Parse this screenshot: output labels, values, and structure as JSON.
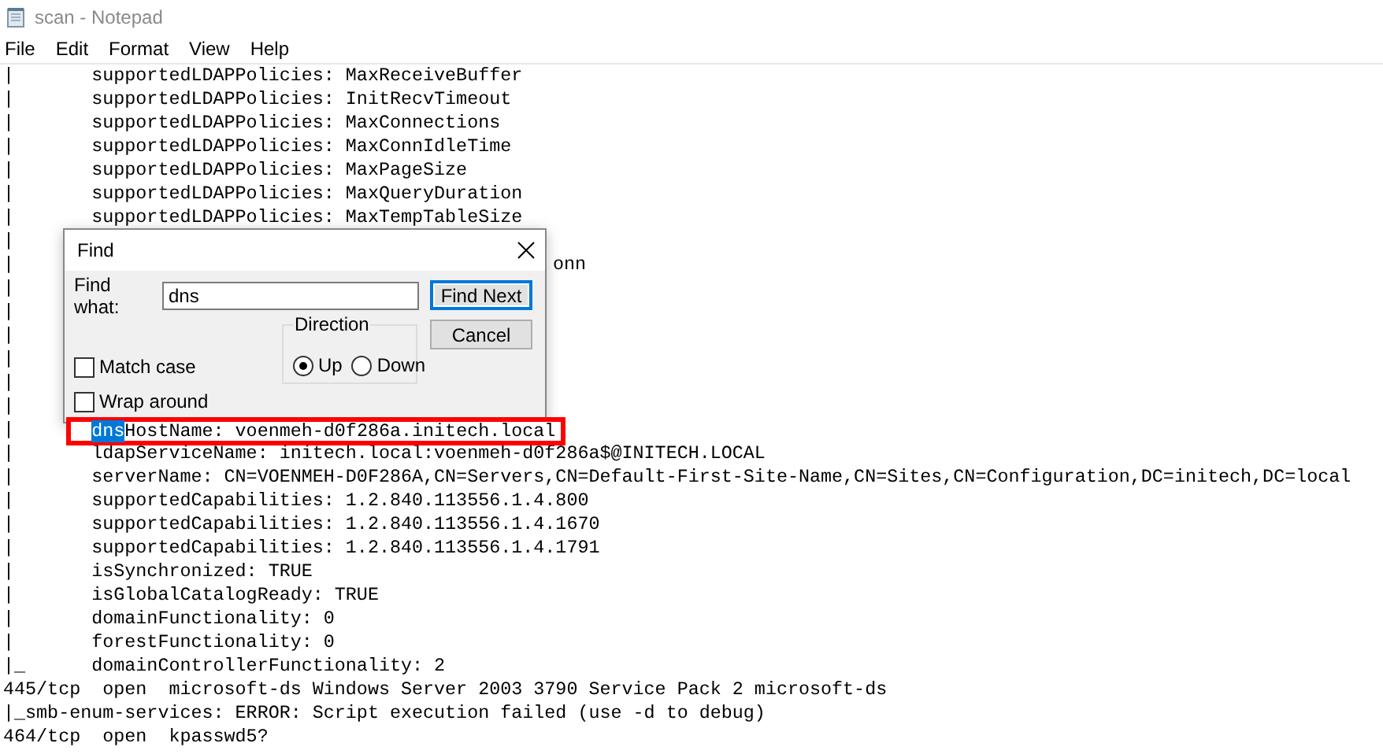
{
  "window": {
    "title": "scan - Notepad"
  },
  "menu": [
    "File",
    "Edit",
    "Format",
    "View",
    "Help"
  ],
  "lines": [
    {
      "kind": "plain",
      "text": "|       supportedLDAPPolicies: MaxReceiveBuffer"
    },
    {
      "kind": "plain",
      "text": "|       supportedLDAPPolicies: InitRecvTimeout"
    },
    {
      "kind": "plain",
      "text": "|       supportedLDAPPolicies: MaxConnections"
    },
    {
      "kind": "plain",
      "text": "|       supportedLDAPPolicies: MaxConnIdleTime"
    },
    {
      "kind": "plain",
      "text": "|       supportedLDAPPolicies: MaxPageSize"
    },
    {
      "kind": "plain",
      "text": "|       supportedLDAPPolicies: MaxQueryDuration"
    },
    {
      "kind": "plain",
      "text": "|       supportedLDAPPolicies: MaxTempTableSize"
    },
    {
      "kind": "plain",
      "text": "|"
    },
    {
      "kind": "covered",
      "text": "|",
      "tail": "onn"
    },
    {
      "kind": "plain",
      "text": "|"
    },
    {
      "kind": "plain",
      "text": "|"
    },
    {
      "kind": "plain",
      "text": "|"
    },
    {
      "kind": "plain",
      "text": "|"
    },
    {
      "kind": "plain",
      "text": "|"
    },
    {
      "kind": "plain",
      "text": "|"
    },
    {
      "kind": "match",
      "text": "|       ",
      "match": "dns",
      "tail": "HostName: voenmeh-d0f286a.initech.local",
      "outlined": true
    },
    {
      "kind": "plain",
      "text": "|       ldapServiceName: initech.local:voenmeh-d0f286a$@INITECH.LOCAL"
    },
    {
      "kind": "plain",
      "text": "|       serverName: CN=VOENMEH-D0F286A,CN=Servers,CN=Default-First-Site-Name,CN=Sites,CN=Configuration,DC=initech,DC=local"
    },
    {
      "kind": "plain",
      "text": "|       supportedCapabilities: 1.2.840.113556.1.4.800"
    },
    {
      "kind": "plain",
      "text": "|       supportedCapabilities: 1.2.840.113556.1.4.1670"
    },
    {
      "kind": "plain",
      "text": "|       supportedCapabilities: 1.2.840.113556.1.4.1791"
    },
    {
      "kind": "plain",
      "text": "|       isSynchronized: TRUE"
    },
    {
      "kind": "plain",
      "text": "|       isGlobalCatalogReady: TRUE"
    },
    {
      "kind": "plain",
      "text": "|       domainFunctionality: 0"
    },
    {
      "kind": "plain",
      "text": "|       forestFunctionality: 0"
    },
    {
      "kind": "plain",
      "text": "|_      domainControllerFunctionality: 2"
    },
    {
      "kind": "plain",
      "text": "445/tcp  open  microsoft-ds Windows Server 2003 3790 Service Pack 2 microsoft-ds"
    },
    {
      "kind": "plain",
      "text": "|_smb-enum-services: ERROR: Script execution failed (use -d to debug)"
    },
    {
      "kind": "plain",
      "text": "464/tcp  open  kpasswd5?"
    }
  ],
  "find_dialog": {
    "title": "Find",
    "find_what_label": "Find what:",
    "value": "dns",
    "buttons": [
      {
        "label": "Find Next",
        "focused": true
      },
      {
        "label": "Cancel",
        "focused": false
      }
    ],
    "direction": {
      "label": "Direction",
      "options": [
        {
          "label": "Up",
          "selected": true
        },
        {
          "label": "Down",
          "selected": false
        }
      ]
    },
    "checkboxes": [
      {
        "label": "Match case",
        "checked": false
      },
      {
        "label": "Wrap around",
        "checked": false
      }
    ]
  }
}
